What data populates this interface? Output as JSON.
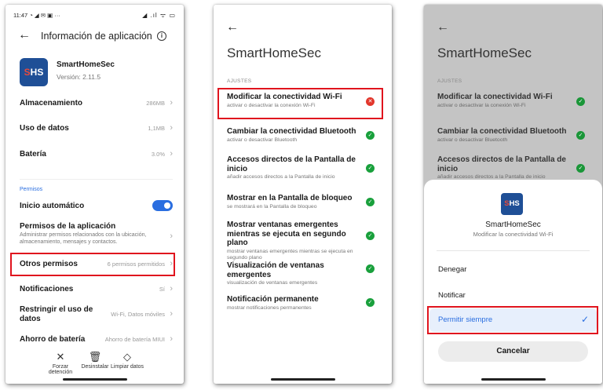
{
  "screen1": {
    "status": {
      "time": "11:47",
      "icons": "◔ ◢ ✉ ▣ ···",
      "right": "◢ .ıl ᯤ ▭"
    },
    "title": "Información de aplicación",
    "app": {
      "icon_text_s": "S",
      "icon_text_rest": "HS",
      "name": "SmartHomeSec",
      "version": "Versión: 2.11.5"
    },
    "rows": {
      "almacenamiento": {
        "label": "Almacenamiento",
        "value": "286MB"
      },
      "uso_datos": {
        "label": "Uso de datos",
        "value": "1,1MB"
      },
      "bateria": {
        "label": "Batería",
        "value": "3.0%"
      }
    },
    "permisos_section": "Permisos",
    "inicio_automatico": "Inicio automático",
    "permisos_app": {
      "label": "Permisos de la aplicación",
      "desc": "Administrar permisos relacionados con la ubicación, almacenamiento, mensajes y contactos."
    },
    "otros_permisos": {
      "label": "Otros permisos",
      "value": "6 permisos permitidos"
    },
    "notificaciones": {
      "label": "Notificaciones",
      "value": "Sí"
    },
    "restringir": {
      "label": "Restringir el uso de datos",
      "value": "Wi-Fi, Datos móviles"
    },
    "ahorro": {
      "label": "Ahorro de batería",
      "value": "Ahorro de batería MIUI"
    },
    "actions": {
      "forzar": "Forzar detención",
      "desinstalar": "Desinstalar",
      "limpiar": "Limpiar datos"
    },
    "colors": {
      "accent": "#2a6ee0",
      "highlight": "#e0141e"
    }
  },
  "screen2": {
    "title": "SmartHomeSec",
    "section": "AJUSTES",
    "items": [
      {
        "title": "Modificar la conectividad Wi-Fi",
        "desc": "activar o desactivar la conexión Wi-Fi",
        "status": "denied"
      },
      {
        "title": "Cambiar la conectividad Bluetooth",
        "desc": "activar o desactivar Bluetooth",
        "status": "allowed"
      },
      {
        "title": "Accesos directos de la Pantalla de inicio",
        "desc": "añadir accesos directos a la Pantalla de inicio",
        "status": "allowed"
      },
      {
        "title": "Mostrar en la Pantalla de bloqueo",
        "desc": "se mostrará en la Pantalla de bloqueo",
        "status": "allowed"
      },
      {
        "title": "Mostrar ventanas emergentes mientras se ejecuta en segundo plano",
        "desc": "mostrar ventanas emergentes mientras se ejecuta en segundo plano",
        "status": "allowed"
      },
      {
        "title": "Visualización de ventanas emergentes",
        "desc": "visualización de ventanas emergentes",
        "status": "allowed"
      },
      {
        "title": "Notificación permanente",
        "desc": "mostrar notificaciones permanentes",
        "status": "allowed"
      }
    ]
  },
  "screen3": {
    "title": "SmartHomeSec",
    "section": "AJUSTES",
    "items": [
      {
        "title": "Modificar la conectividad Wi-Fi",
        "desc": "activar o desactivar la conexión Wi-Fi"
      },
      {
        "title": "Cambiar la conectividad Bluetooth",
        "desc": "activar o desactivar Bluetooth"
      },
      {
        "title": "Accesos directos de la Pantalla de inicio",
        "desc": "añadir accesos directos a la Pantalla de inicio"
      }
    ],
    "sheet": {
      "app_name": "SmartHomeSec",
      "subtitle": "Modificar la conectividad Wi-Fi",
      "options": [
        "Denegar",
        "Notificar",
        "Permitir siempre"
      ],
      "selected": "Permitir siempre",
      "cancel": "Cancelar"
    }
  }
}
